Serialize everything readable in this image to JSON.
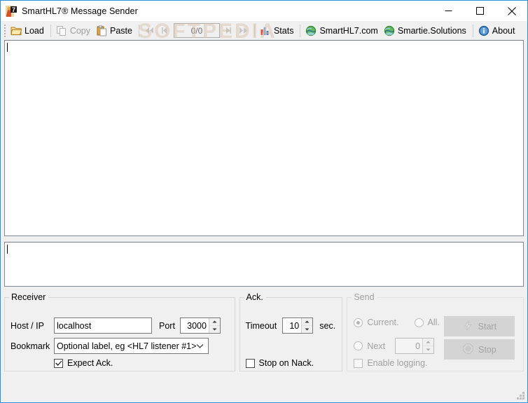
{
  "window": {
    "title": "SmartHL7® Message Sender",
    "app_icon": "smarthl7-app-icon",
    "minimize_label": "Minimize",
    "maximize_label": "Maximize",
    "close_label": "Close"
  },
  "watermark": {
    "text": "SOFTPEDIA"
  },
  "toolbar": {
    "load_label": "Load",
    "copy_label": "Copy",
    "paste_label": "Paste",
    "first_label": "First message",
    "prev_label": "Previous message",
    "counter_value": "0/0",
    "next_label": "Next message",
    "last_label": "Last message",
    "stats_label": "Stats",
    "site_label": "SmartHL7.com",
    "solutions_label": "Smartie.Solutions",
    "about_label": "About"
  },
  "editor": {
    "message_text": "",
    "log_text": ""
  },
  "receiver": {
    "legend": "Receiver",
    "host_label": "Host / IP",
    "host_value": "localhost",
    "host_placeholder": "",
    "port_label": "Port",
    "port_value": "3000",
    "bookmark_label": "Bookmark",
    "bookmark_value": "Optional label, eg <HL7 listener #1>",
    "expect_ack_label": "Expect Ack.",
    "expect_ack_checked": "checked"
  },
  "ack": {
    "legend": "Ack.",
    "timeout_label": "Timeout",
    "timeout_value": "10",
    "unit_label": "sec.",
    "stop_on_nack_label": "Stop on Nack."
  },
  "send": {
    "legend": "Send",
    "current_label": "Current.",
    "all_label": "All.",
    "next_label": "Next",
    "next_value": "0",
    "enable_logging_label": "Enable logging.",
    "start_label": "Start",
    "stop_label": "Stop"
  },
  "colors": {
    "window_border": "#2f8fd8",
    "face": "#f0f0f0",
    "disabled_text": "#a0a0a0",
    "text": "#000000",
    "field_border": "#7a7a7a",
    "button_face": "#d4d4d4"
  }
}
